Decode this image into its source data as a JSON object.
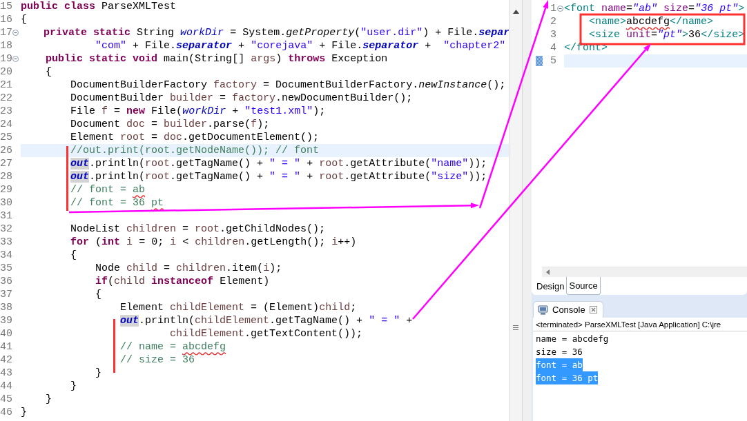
{
  "java_editor": {
    "lines": [
      {
        "number": "15",
        "fold": false,
        "current": false,
        "tokens": [
          {
            "kind": "keyword",
            "text": "public"
          },
          {
            "kind": "keyword",
            "text": " class"
          },
          {
            "kind": "plain",
            "text": " ParseXMLTest"
          }
        ]
      },
      {
        "number": "16",
        "fold": false,
        "current": false,
        "tokens": [
          {
            "kind": "plain",
            "text": "{"
          }
        ]
      },
      {
        "number": "17",
        "fold": true,
        "current": false,
        "tokens": [
          {
            "kind": "keyword",
            "text": "    private"
          },
          {
            "kind": "keyword",
            "text": " static"
          },
          {
            "kind": "plain",
            "text": " String "
          },
          {
            "kind": "static-field",
            "text": "workDir"
          },
          {
            "kind": "plain",
            "text": " = System."
          },
          {
            "kind": "static-method",
            "text": "getProperty"
          },
          {
            "kind": "plain",
            "text": "("
          },
          {
            "kind": "string",
            "text": "\"user.dir\""
          },
          {
            "kind": "plain",
            "text": ") + File."
          },
          {
            "kind": "constant",
            "text": "separ"
          }
        ]
      },
      {
        "number": "18",
        "fold": false,
        "current": false,
        "tokens": [
          {
            "kind": "string",
            "text": "            \"com\""
          },
          {
            "kind": "plain",
            "text": " + File."
          },
          {
            "kind": "constant",
            "text": "separator"
          },
          {
            "kind": "plain",
            "text": " + "
          },
          {
            "kind": "string",
            "text": "\"corejava\""
          },
          {
            "kind": "plain",
            "text": " + File."
          },
          {
            "kind": "constant",
            "text": "separator"
          },
          {
            "kind": "plain",
            "text": " +  "
          },
          {
            "kind": "string",
            "text": "\"chapter2\""
          }
        ]
      },
      {
        "number": "19",
        "fold": true,
        "current": false,
        "tokens": [
          {
            "kind": "keyword",
            "text": "    public"
          },
          {
            "kind": "keyword",
            "text": " static"
          },
          {
            "kind": "keyword",
            "text": " void"
          },
          {
            "kind": "plain",
            "text": " main(String[] "
          },
          {
            "kind": "local",
            "text": "args"
          },
          {
            "kind": "plain",
            "text": ") "
          },
          {
            "kind": "keyword",
            "text": "throws"
          },
          {
            "kind": "plain",
            "text": " Exception"
          }
        ]
      },
      {
        "number": "20",
        "fold": false,
        "current": false,
        "tokens": [
          {
            "kind": "plain",
            "text": "    {"
          }
        ]
      },
      {
        "number": "21",
        "fold": false,
        "current": false,
        "tokens": [
          {
            "kind": "plain",
            "text": "        DocumentBuilderFactory "
          },
          {
            "kind": "local",
            "text": "factory"
          },
          {
            "kind": "plain",
            "text": " = DocumentBuilderFactory."
          },
          {
            "kind": "static-method",
            "text": "newInstance"
          },
          {
            "kind": "plain",
            "text": "();"
          }
        ]
      },
      {
        "number": "22",
        "fold": false,
        "current": false,
        "tokens": [
          {
            "kind": "plain",
            "text": "        DocumentBuilder "
          },
          {
            "kind": "local",
            "text": "builder"
          },
          {
            "kind": "plain",
            "text": " = "
          },
          {
            "kind": "local",
            "text": "factory"
          },
          {
            "kind": "plain",
            "text": ".newDocumentBuilder();"
          }
        ]
      },
      {
        "number": "23",
        "fold": false,
        "current": false,
        "tokens": [
          {
            "kind": "plain",
            "text": "        File "
          },
          {
            "kind": "local",
            "text": "f"
          },
          {
            "kind": "plain",
            "text": " = "
          },
          {
            "kind": "keyword",
            "text": "new"
          },
          {
            "kind": "plain",
            "text": " File("
          },
          {
            "kind": "static-field",
            "text": "workDir"
          },
          {
            "kind": "plain",
            "text": " + "
          },
          {
            "kind": "string",
            "text": "\"test1.xml\""
          },
          {
            "kind": "plain",
            "text": ");"
          }
        ]
      },
      {
        "number": "24",
        "fold": false,
        "current": false,
        "tokens": [
          {
            "kind": "plain",
            "text": "        Document "
          },
          {
            "kind": "local",
            "text": "doc"
          },
          {
            "kind": "plain",
            "text": " = "
          },
          {
            "kind": "local",
            "text": "builder"
          },
          {
            "kind": "plain",
            "text": ".parse("
          },
          {
            "kind": "local",
            "text": "f"
          },
          {
            "kind": "plain",
            "text": ");"
          }
        ]
      },
      {
        "number": "25",
        "fold": false,
        "current": false,
        "tokens": [
          {
            "kind": "plain",
            "text": "        Element "
          },
          {
            "kind": "local",
            "text": "root"
          },
          {
            "kind": "plain",
            "text": " = "
          },
          {
            "kind": "local",
            "text": "doc"
          },
          {
            "kind": "plain",
            "text": ".getDocumentElement();"
          }
        ]
      },
      {
        "number": "26",
        "fold": false,
        "current": true,
        "tokens": [
          {
            "kind": "comment",
            "text": "        //out.print(root.getNodeName()); // font"
          }
        ]
      },
      {
        "number": "27",
        "fold": false,
        "current": false,
        "tokens": [
          {
            "kind": "constant-marked",
            "text": "        out"
          },
          {
            "kind": "plain",
            "text": ".println("
          },
          {
            "kind": "local",
            "text": "root"
          },
          {
            "kind": "plain",
            "text": ".getTagName() + "
          },
          {
            "kind": "string",
            "text": "\" = \""
          },
          {
            "kind": "plain",
            "text": " + "
          },
          {
            "kind": "local",
            "text": "root"
          },
          {
            "kind": "plain",
            "text": ".getAttribute("
          },
          {
            "kind": "string",
            "text": "\"name\""
          },
          {
            "kind": "plain",
            "text": "));"
          }
        ]
      },
      {
        "number": "28",
        "fold": false,
        "current": false,
        "tokens": [
          {
            "kind": "constant-marked",
            "text": "        out"
          },
          {
            "kind": "plain",
            "text": ".println("
          },
          {
            "kind": "local",
            "text": "root"
          },
          {
            "kind": "plain",
            "text": ".getTagName() + "
          },
          {
            "kind": "string",
            "text": "\" = \""
          },
          {
            "kind": "plain",
            "text": " + "
          },
          {
            "kind": "local",
            "text": "root"
          },
          {
            "kind": "plain",
            "text": ".getAttribute("
          },
          {
            "kind": "string",
            "text": "\"size\""
          },
          {
            "kind": "plain",
            "text": "));"
          }
        ]
      },
      {
        "number": "29",
        "fold": false,
        "current": false,
        "tokens": [
          {
            "kind": "comment",
            "text": "        // font = "
          },
          {
            "kind": "comment-misspelled",
            "text": "ab"
          }
        ]
      },
      {
        "number": "30",
        "fold": false,
        "current": false,
        "tokens": [
          {
            "kind": "comment",
            "text": "        // font = 36 "
          },
          {
            "kind": "comment-misspelled",
            "text": "pt"
          }
        ]
      },
      {
        "number": "31",
        "fold": false,
        "current": false
      },
      {
        "number": "32",
        "fold": false,
        "current": false,
        "tokens": [
          {
            "kind": "plain",
            "text": "        NodeList "
          },
          {
            "kind": "local",
            "text": "children"
          },
          {
            "kind": "plain",
            "text": " = "
          },
          {
            "kind": "local",
            "text": "root"
          },
          {
            "kind": "plain",
            "text": ".getChildNodes();"
          }
        ]
      },
      {
        "number": "33",
        "fold": false,
        "current": false,
        "tokens": [
          {
            "kind": "keyword",
            "text": "        for"
          },
          {
            "kind": "plain",
            "text": " ("
          },
          {
            "kind": "keyword",
            "text": "int"
          },
          {
            "kind": "local",
            "text": " i"
          },
          {
            "kind": "plain",
            "text": " = 0; "
          },
          {
            "kind": "local",
            "text": "i"
          },
          {
            "kind": "plain",
            "text": " < "
          },
          {
            "kind": "local",
            "text": "children"
          },
          {
            "kind": "plain",
            "text": ".getLength(); "
          },
          {
            "kind": "local",
            "text": "i"
          },
          {
            "kind": "plain",
            "text": "++)"
          }
        ]
      },
      {
        "number": "34",
        "fold": false,
        "current": false,
        "tokens": [
          {
            "kind": "plain",
            "text": "        {"
          }
        ]
      },
      {
        "number": "35",
        "fold": false,
        "current": false,
        "tokens": [
          {
            "kind": "plain",
            "text": "            Node "
          },
          {
            "kind": "local",
            "text": "child"
          },
          {
            "kind": "plain",
            "text": " = "
          },
          {
            "kind": "local",
            "text": "children"
          },
          {
            "kind": "plain",
            "text": ".item("
          },
          {
            "kind": "local",
            "text": "i"
          },
          {
            "kind": "plain",
            "text": ");"
          }
        ]
      },
      {
        "number": "36",
        "fold": false,
        "current": false,
        "tokens": [
          {
            "kind": "keyword",
            "text": "            if"
          },
          {
            "kind": "plain",
            "text": "("
          },
          {
            "kind": "local",
            "text": "child"
          },
          {
            "kind": "keyword",
            "text": " instanceof"
          },
          {
            "kind": "plain",
            "text": " Element)"
          }
        ]
      },
      {
        "number": "37",
        "fold": false,
        "current": false,
        "tokens": [
          {
            "kind": "plain",
            "text": "            {"
          }
        ]
      },
      {
        "number": "38",
        "fold": false,
        "current": false,
        "tokens": [
          {
            "kind": "plain",
            "text": "                Element "
          },
          {
            "kind": "local",
            "text": "childElement"
          },
          {
            "kind": "plain",
            "text": " = (Element)"
          },
          {
            "kind": "local",
            "text": "child"
          },
          {
            "kind": "plain",
            "text": ";"
          }
        ]
      },
      {
        "number": "39",
        "fold": false,
        "current": false,
        "tokens": [
          {
            "kind": "constant-marked",
            "text": "                out"
          },
          {
            "kind": "plain",
            "text": ".println("
          },
          {
            "kind": "local",
            "text": "childElement"
          },
          {
            "kind": "plain",
            "text": ".getTagName() + "
          },
          {
            "kind": "string",
            "text": "\" = \""
          },
          {
            "kind": "plain",
            "text": " +"
          }
        ]
      },
      {
        "number": "40",
        "fold": false,
        "current": false,
        "tokens": [
          {
            "kind": "local",
            "text": "                        childElement"
          },
          {
            "kind": "plain",
            "text": ".getTextContent());"
          }
        ]
      },
      {
        "number": "41",
        "fold": false,
        "current": false,
        "tokens": [
          {
            "kind": "comment",
            "text": "                // name = "
          },
          {
            "kind": "comment-misspelled",
            "text": "abcdefg"
          }
        ]
      },
      {
        "number": "42",
        "fold": false,
        "current": false,
        "tokens": [
          {
            "kind": "comment",
            "text": "                // size = 36"
          }
        ]
      },
      {
        "number": "43",
        "fold": false,
        "current": false,
        "tokens": [
          {
            "kind": "plain",
            "text": "            }"
          }
        ]
      },
      {
        "number": "44",
        "fold": false,
        "current": false,
        "tokens": [
          {
            "kind": "plain",
            "text": "        }"
          }
        ]
      },
      {
        "number": "45",
        "fold": false,
        "current": false,
        "tokens": [
          {
            "kind": "plain",
            "text": "    }"
          }
        ]
      },
      {
        "number": "46",
        "fold": false,
        "current": false,
        "tokens": [
          {
            "kind": "plain",
            "text": "}"
          }
        ]
      }
    ]
  },
  "xml_editor": {
    "lines": [
      {
        "number": "1",
        "fold": true,
        "current": false,
        "changed": false,
        "tokens": [
          {
            "kind": "tag",
            "text": "<font"
          },
          {
            "kind": "attribute",
            "text": " name"
          },
          {
            "kind": "plain",
            "text": "="
          },
          {
            "kind": "value",
            "text": "\"ab\""
          },
          {
            "kind": "attribute",
            "text": " size"
          },
          {
            "kind": "plain",
            "text": "="
          },
          {
            "kind": "value",
            "text": "\"36 pt\""
          },
          {
            "kind": "tag",
            "text": ">"
          }
        ]
      },
      {
        "number": "2",
        "fold": false,
        "current": false,
        "changed": false,
        "tokens": [
          {
            "kind": "tag",
            "text": "    <name>"
          },
          {
            "kind": "text-misspelled",
            "text": "abcdefg"
          },
          {
            "kind": "tag",
            "text": "</name>"
          }
        ]
      },
      {
        "number": "3",
        "fold": false,
        "current": false,
        "changed": false,
        "tokens": [
          {
            "kind": "tag",
            "text": "    <size"
          },
          {
            "kind": "attribute",
            "text": " unit"
          },
          {
            "kind": "plain",
            "text": "="
          },
          {
            "kind": "value",
            "text": "\"pt\""
          },
          {
            "kind": "tag",
            "text": ">"
          },
          {
            "kind": "plain",
            "text": "36"
          },
          {
            "kind": "tag",
            "text": "</size>"
          }
        ]
      },
      {
        "number": "4",
        "fold": false,
        "current": false,
        "changed": false,
        "tokens": [
          {
            "kind": "tag",
            "text": "</font>"
          }
        ]
      },
      {
        "number": "5",
        "fold": false,
        "current": true,
        "changed": true
      }
    ],
    "tabs": [
      {
        "label": "Design",
        "selected": false
      },
      {
        "label": "Source",
        "selected": true
      }
    ]
  },
  "console": {
    "tab": {
      "label": "Console"
    },
    "header": "<terminated> ParseXMLTest [Java Application] C:\\jre",
    "lines": [
      {
        "text": "name = abcdefg",
        "selected": false
      },
      {
        "text": "size = 36",
        "selected": false
      },
      {
        "text": "font = ab",
        "selected": true
      },
      {
        "text": "font = 36 pt",
        "selected": true
      }
    ]
  }
}
